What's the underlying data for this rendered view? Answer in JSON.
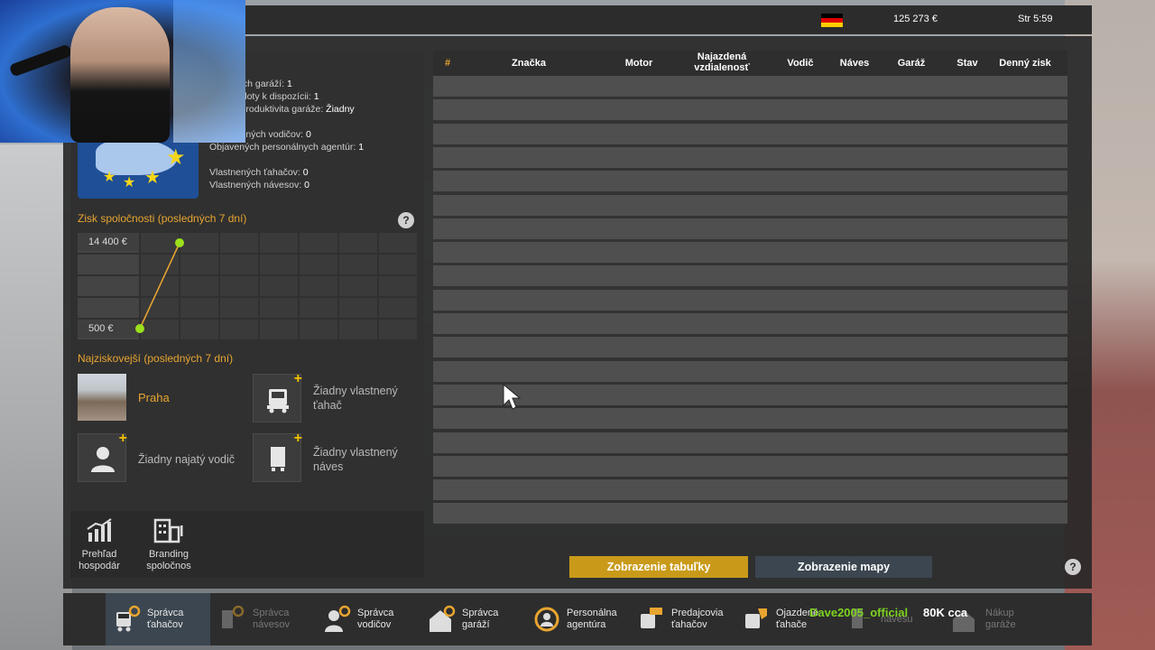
{
  "topbar": {
    "money": "125 273 €",
    "clock": "Str 5:59"
  },
  "stats": [
    {
      "label": "nných garáží:",
      "value": "1"
    },
    {
      "label": "ké sloty k dispozícii:",
      "value": "1"
    },
    {
      "label": "ná produktivita garáže:",
      "value": "Žiadny"
    },
    {
      "label": "manných vodičov:",
      "value": "0"
    },
    {
      "label": "Objavených personálnych agentúr:",
      "value": "1"
    },
    {
      "label": "Vlastnených ťahačov:",
      "value": "0"
    },
    {
      "label": "Vlastnených návesov:",
      "value": "0"
    }
  ],
  "profit_section": {
    "title": "Zisk spoločnosti (posledných 7 dní)",
    "help": "?"
  },
  "chart_data": {
    "type": "line",
    "y_ticks": [
      "14 400 €",
      "500 €"
    ],
    "points": [
      {
        "index": 0,
        "value": 500
      },
      {
        "index": 1,
        "value": 14400
      }
    ],
    "ylim": [
      500,
      14400
    ],
    "grid": true
  },
  "top_section": {
    "title": "Najziskovejší (posledných 7 dní)",
    "garage": "Praha",
    "truck": "Žiadny vlastnený ťahač",
    "driver": "Žiadny najatý vodič",
    "trailer": "Žiadny vlastnený náves"
  },
  "lower_buttons": [
    {
      "label": "Prehľad hospodár"
    },
    {
      "label": "Branding spoločnos"
    }
  ],
  "table": {
    "headers": [
      "#",
      "Značka",
      "Motor",
      "Najazdená vzdialenosť",
      "Vodič",
      "Náves",
      "Garáž",
      "Stav",
      "Denný zisk"
    ],
    "row_count": 19
  },
  "view_buttons": {
    "table": "Zobrazenie tabuľky",
    "map": "Zobrazenie mapy",
    "help": "?"
  },
  "nav": [
    {
      "label": "Správca ťahačov",
      "icon": "truck-gear-icon"
    },
    {
      "label": "Správca návesov",
      "icon": "trailer-gear-icon"
    },
    {
      "label": "Správca vodičov",
      "icon": "driver-gear-icon"
    },
    {
      "label": "Správca garáží",
      "icon": "garage-gear-icon"
    },
    {
      "label": "Personálna agentúra",
      "icon": "agency-icon"
    },
    {
      "label": "Predajcovia ťahačov",
      "icon": "dealer-icon"
    },
    {
      "label": "Ojazdené ťahače",
      "icon": "used-truck-icon"
    },
    {
      "label": "návesu",
      "icon": "trailer-icon"
    },
    {
      "label": "Nákup garáže",
      "icon": "buy-garage-icon"
    }
  ],
  "overlay": {
    "name": "Dave2005_official",
    "text": "80K cca"
  },
  "colors": {
    "accent": "#e8a530",
    "yellow_button": "#c99a1a",
    "map_button": "#3c4650",
    "chart_line": "#e8a530",
    "chart_point": "#9be01c"
  }
}
